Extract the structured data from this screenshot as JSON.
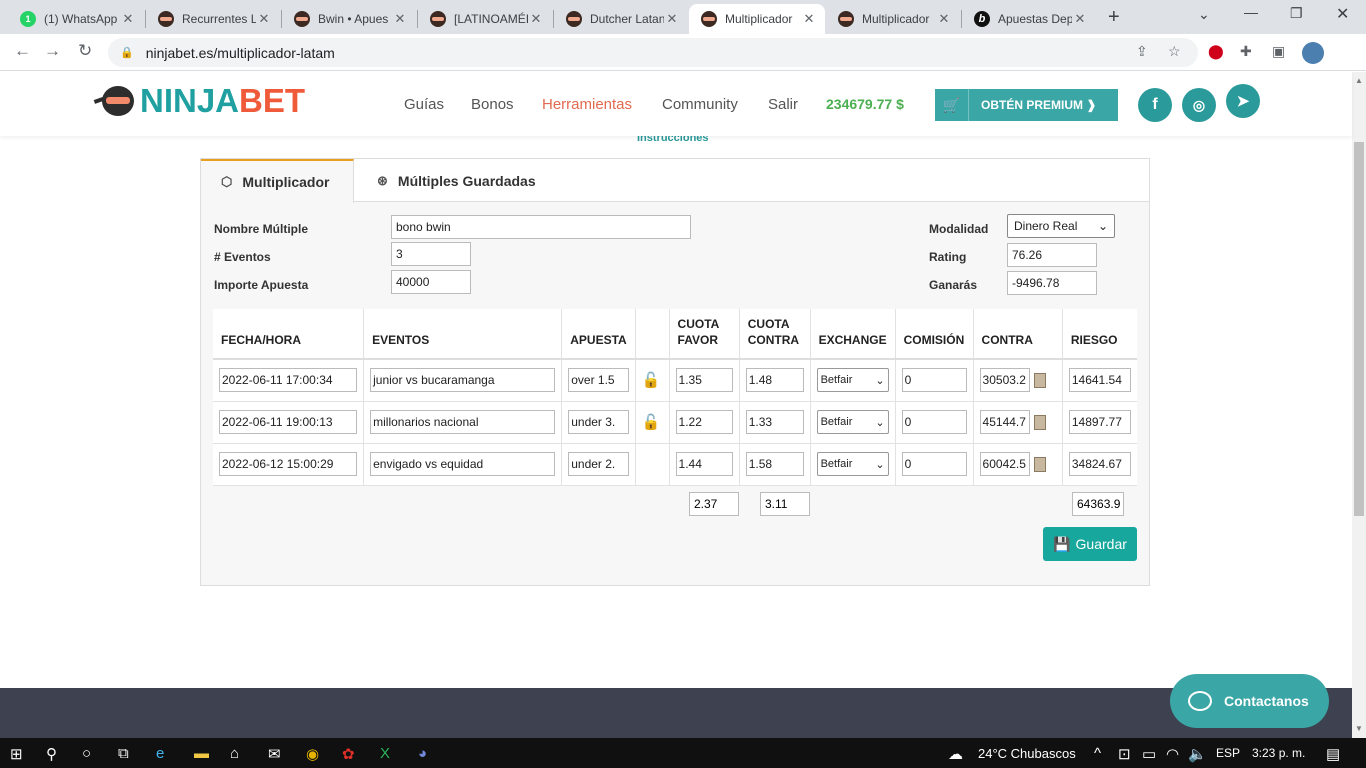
{
  "browser": {
    "tabs": [
      {
        "title": "(1) WhatsApp",
        "favicon": "whatsapp-icon"
      },
      {
        "title": "Recurrentes L",
        "favicon": "ninjabet-icon"
      },
      {
        "title": "Bwin • Apues",
        "favicon": "ninjabet-icon"
      },
      {
        "title": "[LATINOAMÉI",
        "favicon": "ninjabet-icon"
      },
      {
        "title": "Dutcher Latan",
        "favicon": "ninjabet-icon"
      },
      {
        "title": "Multiplicador",
        "favicon": "ninjabet-icon",
        "active": true
      },
      {
        "title": "Multiplicador",
        "favicon": "ninjabet-icon"
      },
      {
        "title": "Apuestas Dep",
        "favicon": "bwin-icon"
      }
    ],
    "url": "ninjabet.es/multiplicador-latam"
  },
  "header": {
    "logo_part1": "NINJA",
    "logo_part2": "BET",
    "menu": [
      "Guías",
      "Bonos",
      "Herramientas",
      "Community",
      "Salir"
    ],
    "active_menu": "Herramientas",
    "balance": "234679.77 $",
    "premium_label": "OBTÉN PREMIUM ❱"
  },
  "instructions_link": "Instrucciones",
  "panel": {
    "tabs": [
      "Multiplicador",
      "Múltiples Guardadas"
    ],
    "form": {
      "nombre_label": "Nombre Múltiple",
      "nombre_value": "bono bwin",
      "eventos_label": "# Eventos",
      "eventos_value": "3",
      "importe_label": "Importe Apuesta",
      "importe_value": "40000",
      "modalidad_label": "Modalidad",
      "modalidad_value": "Dinero Real",
      "rating_label": "Rating",
      "rating_value": "76.26",
      "ganaras_label": "Ganarás",
      "ganaras_value": "-9496.78"
    },
    "table": {
      "headers": [
        "FECHA/HORA",
        "EVENTOS",
        "APUESTA",
        "",
        "CUOTA FAVOR",
        "CUOTA CONTRA",
        "EXCHANGE",
        "COMISIÓN",
        "CONTRA",
        "RIESGO"
      ],
      "rows": [
        {
          "fecha": "2022-06-11 17:00:34",
          "evento": "junior vs bucaramanga",
          "apuesta": "over 1.5",
          "locked": true,
          "favor": "1.35",
          "contra_cuota": "1.48",
          "exchange": "Betfair",
          "comision": "0",
          "contra": "30503.2",
          "riesgo": "14641.54"
        },
        {
          "fecha": "2022-06-11 19:00:13",
          "evento": "millonarios nacional",
          "apuesta": "under 3.",
          "locked": true,
          "favor": "1.22",
          "contra_cuota": "1.33",
          "exchange": "Betfair",
          "comision": "0",
          "contra": "45144.7",
          "riesgo": "14897.77"
        },
        {
          "fecha": "2022-06-12 15:00:29",
          "evento": "envigado vs equidad",
          "apuesta": "under 2.",
          "locked": false,
          "favor": "1.44",
          "contra_cuota": "1.58",
          "exchange": "Betfair",
          "comision": "0",
          "contra": "60042.5",
          "riesgo": "34824.67"
        }
      ],
      "totals": {
        "favor": "2.37",
        "contra": "3.11",
        "riesgo": "64363.9"
      }
    },
    "save_label": "Guardar"
  },
  "contact_label": "Contactanos",
  "taskbar": {
    "weather": "24°C  Chubascos",
    "lang": "ESP",
    "time": "3:23 p. m."
  }
}
